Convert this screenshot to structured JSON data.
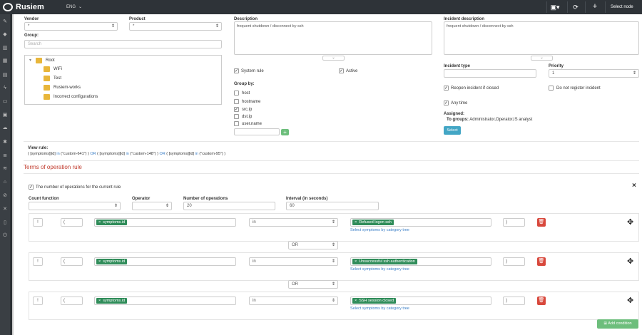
{
  "app": {
    "brand": "Rusiem",
    "lang": "ENG",
    "select_node": "Select node"
  },
  "form": {
    "vendor_label": "Vendor",
    "vendor_value": "*",
    "product_label": "Product",
    "product_value": "*",
    "group_label": "Group:",
    "search_placeholder": "Search",
    "tree": [
      {
        "label": "Root"
      },
      {
        "label": "WiFi"
      },
      {
        "label": "Test"
      },
      {
        "label": "Rusiem-works"
      },
      {
        "label": "Incorrect configurations"
      }
    ],
    "description_label": "Description",
    "description_value": "frequent shutdown / disconnect by ssh",
    "system_rule_label": "System rule",
    "active_label": "Active",
    "group_by_label": "Group by:",
    "group_by_options": [
      {
        "label": "host",
        "checked": false
      },
      {
        "label": "hostname",
        "checked": false
      },
      {
        "label": "src.ip",
        "checked": true
      },
      {
        "label": "dst.ip",
        "checked": false
      },
      {
        "label": "user.name",
        "checked": false
      }
    ],
    "add_symbol": "+",
    "incident_description_label": "Incident description",
    "incident_description_value": "frequent shutdown / disconnect by ssh",
    "incident_type_label": "Incident type",
    "priority_label": "Priority",
    "priority_value": "1",
    "reopen_label": "Reopen incident if closed",
    "not_register_label": "Do not register incident",
    "any_time_label": "Any time",
    "assigned_label": "Assigned:",
    "to_groups_label": "To groups:",
    "to_groups_value": "Administrator,Operator,IS analyst",
    "select_button": "Select",
    "view_rule_label": "View rule:",
    "view_rule_parts": [
      "( [symptoms][id] ",
      "in",
      " (\"custom-641\") ) ",
      "OR",
      " ( [symptoms][id] ",
      "in",
      " (\"custom-148\") ) ",
      "OR",
      " ( [symptoms][id] ",
      "in",
      " (\"custom-95\") )"
    ]
  },
  "terms": {
    "title": "Terms of operation rule",
    "ops_checkbox_label": "The number of operations for the current rule",
    "count_function_label": "Count function",
    "operator_label": "Operator",
    "num_ops_label": "Number of operations",
    "num_ops_value": "20",
    "interval_label": "Interval (in seconds)",
    "interval_value": "60",
    "close_symbol": "×",
    "conditions": [
      {
        "not": "!",
        "open": "(",
        "field": "symptoms.id",
        "op": "in",
        "value": "Refused logon ssh",
        "link": "Select symptoms by category tree",
        "close": ")"
      },
      {
        "not": "!",
        "open": "(",
        "field": "symptoms.id",
        "op": "in",
        "value": "Unsuccessful ssh authentication",
        "link": "Select symptoms by category tree",
        "close": ")"
      },
      {
        "not": "!",
        "open": "(",
        "field": "symptoms.id",
        "op": "in",
        "value": "SSH session closed",
        "link": "Select symptoms by category tree",
        "close": ")"
      }
    ],
    "or_values": [
      "OR",
      "OR"
    ],
    "add_condition": "Add condition"
  }
}
